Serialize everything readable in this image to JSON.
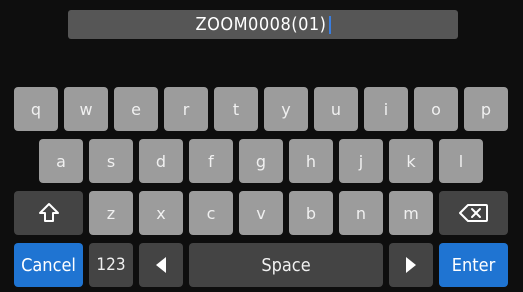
{
  "name_field": {
    "value": "ZOOM0008(01)"
  },
  "keyboard": {
    "row1": [
      "q",
      "w",
      "e",
      "r",
      "t",
      "y",
      "u",
      "i",
      "o",
      "p"
    ],
    "row2": [
      "a",
      "s",
      "d",
      "f",
      "g",
      "h",
      "j",
      "k",
      "l"
    ],
    "row3": [
      "z",
      "x",
      "c",
      "v",
      "b",
      "n",
      "m"
    ],
    "cancel_label": "Cancel",
    "numbers_label": "123",
    "space_label": "Space",
    "enter_label": "Enter",
    "shift_icon": "shift-icon",
    "backspace_icon": "backspace-icon",
    "left_icon": "arrow-left-icon",
    "right_icon": "arrow-right-icon"
  },
  "colors": {
    "background": "#0e0e0e",
    "field": "#565656",
    "letter_key": "#9c9c9c",
    "dark_key": "#444444",
    "accent": "#1f74d2"
  }
}
